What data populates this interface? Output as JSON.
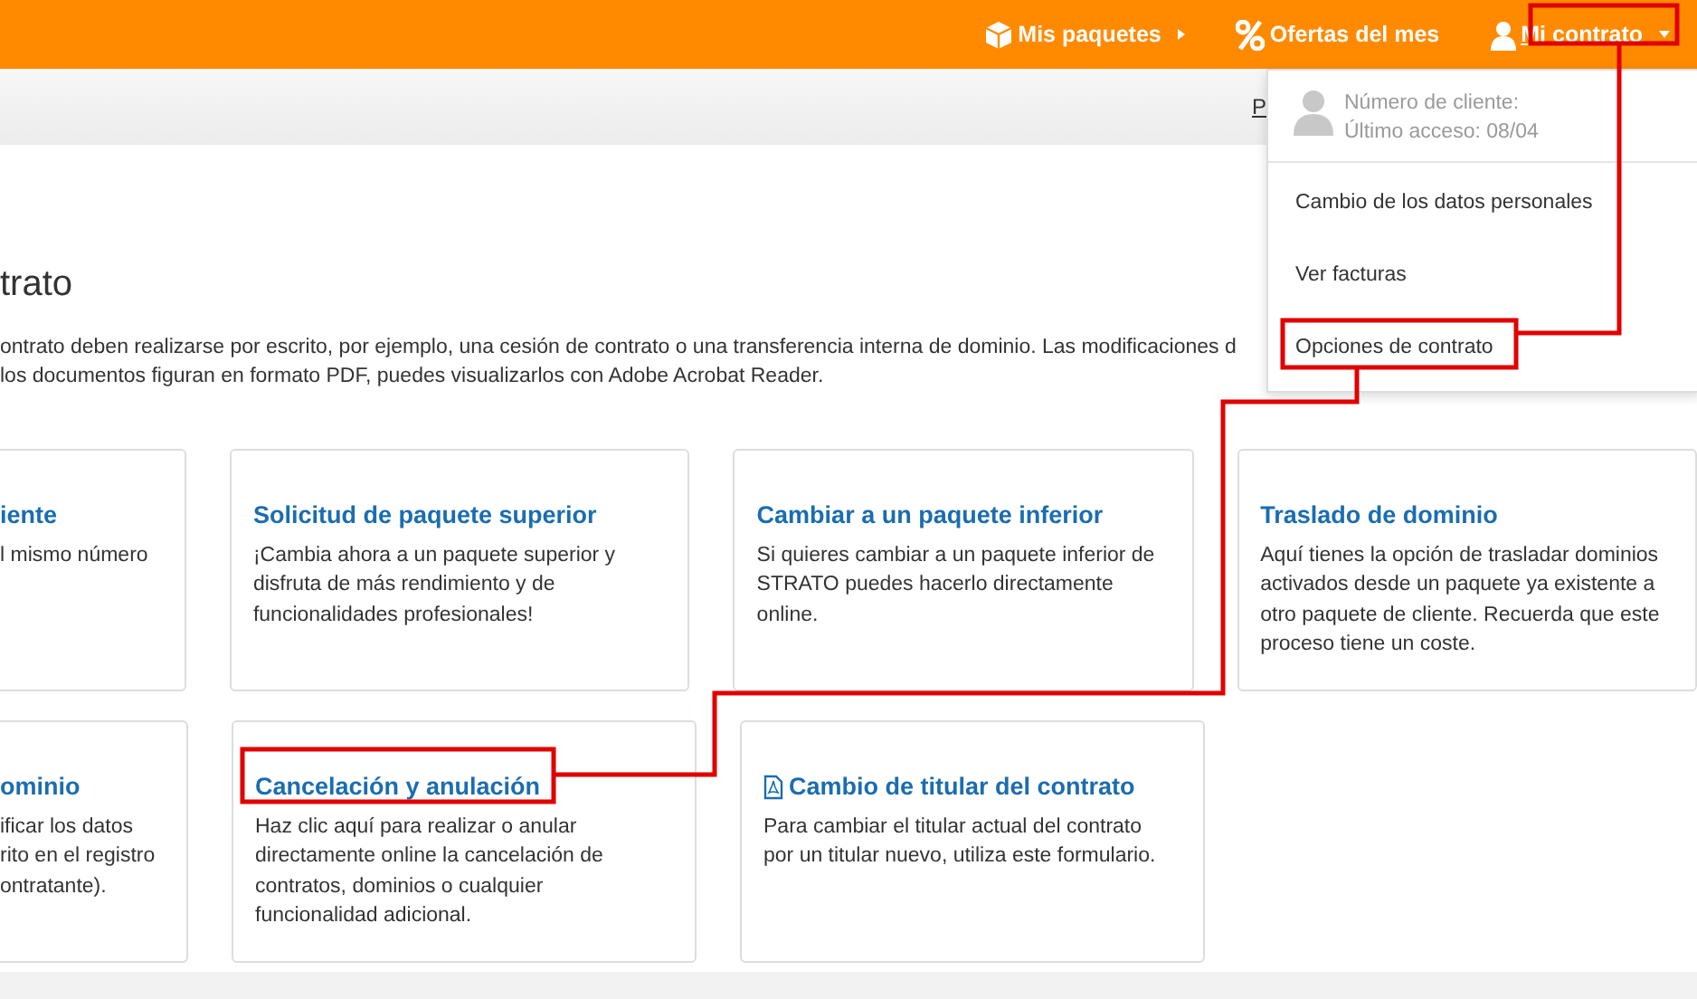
{
  "top_nav": [
    {
      "kind": "box",
      "label": "Mis paquetes",
      "caret": true,
      "selected": false
    },
    {
      "kind": "percent",
      "label": "Ofertas del mes",
      "caret": false,
      "selected": false
    },
    {
      "kind": "user",
      "label": "Mi contrato",
      "caret": true,
      "selected": true
    }
  ],
  "sub_bar": {
    "link": "P"
  },
  "heading": "trato",
  "intro": [
    "ontrato deben realizarse por escrito, por ejemplo, una cesión de contrato o una transferencia interna de dominio. Las modificaciones d",
    "los documentos figuran en formato PDF, puedes visualizarlos con Adobe Acrobat Reader."
  ],
  "card_rows": [
    [
      {
        "kind": "cut",
        "title": "iente",
        "lines": [
          "l mismo número"
        ]
      },
      {
        "kind": "full",
        "title": "Solicitud de paquete superior",
        "lines": [
          "¡Cambia ahora a un paquete superior y",
          "disfruta de más rendimiento y de",
          "funcionalidades profesionales!"
        ]
      },
      {
        "kind": "full",
        "title": "Cambiar a un paquete inferior",
        "lines": [
          "Si quieres cambiar a un paquete inferior de",
          "STRATO puedes hacerlo directamente",
          "online."
        ]
      },
      {
        "kind": "full",
        "title": "Traslado de dominio",
        "lines": [
          "Aquí tienes la opción de trasladar dominios",
          "activados desde un paquete ya existente a",
          "otro paquete de cliente. Recuerda que este",
          "proceso tiene un coste."
        ]
      }
    ],
    [
      {
        "kind": "cut",
        "title": "ominio",
        "lines": [
          "ificar los datos",
          "rito en el registro",
          "ontratante)."
        ]
      },
      {
        "kind": "full",
        "title": "Cancelación y anulación",
        "lines": [
          "Haz clic aquí para realizar o anular",
          "directamente online la cancelación de",
          "contratos, dominios o cualquier",
          "funcionalidad adicional."
        ]
      },
      {
        "kind": "pdf",
        "title": "Cambio de titular del contrato",
        "lines": [
          "Para cambiar el titular actual del contrato",
          "por un titular nuevo, utiliza este formulario."
        ]
      }
    ]
  ],
  "account_menu": {
    "customer_number": "Número de cliente:",
    "last_access": "Último acceso: 08/04",
    "items": [
      "Cambio de los datos personales",
      "Ver facturas",
      "Opciones de contrato"
    ]
  }
}
